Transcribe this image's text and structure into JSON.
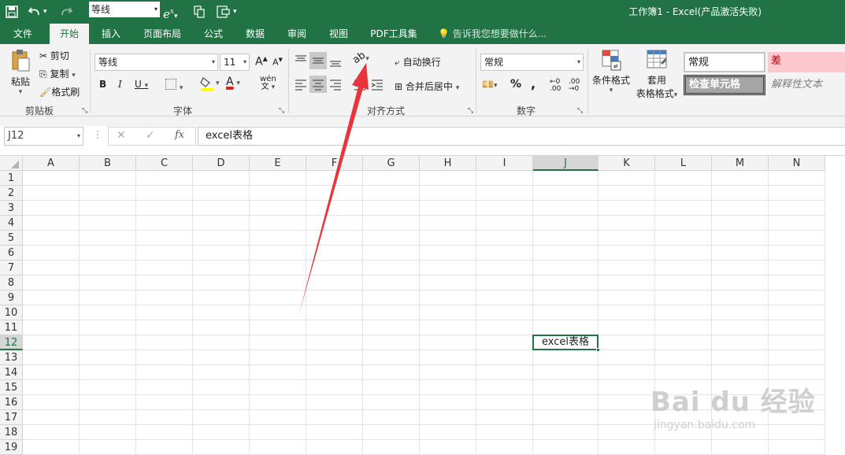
{
  "titlebar": {
    "font_name": "等线",
    "title": "工作簿1 - Excel(产品激活失败)",
    "save_icon": "save-icon",
    "undo_icon": "undo-icon",
    "redo_icon": "redo-icon"
  },
  "tabs": [
    {
      "label": "文件"
    },
    {
      "label": "开始"
    },
    {
      "label": "插入"
    },
    {
      "label": "页面布局"
    },
    {
      "label": "公式"
    },
    {
      "label": "数据"
    },
    {
      "label": "审阅"
    },
    {
      "label": "视图"
    },
    {
      "label": "PDF工具集"
    }
  ],
  "tell_me": "告诉我您想要做什么...",
  "ribbon": {
    "clipboard": {
      "paste": "粘贴",
      "cut": "剪切",
      "copy": "复制",
      "format_painter": "格式刷",
      "label": "剪贴板"
    },
    "font": {
      "name": "等线",
      "size": "11",
      "bold": "B",
      "italic": "I",
      "underline": "U",
      "label": "字体",
      "grow": "A",
      "shrink": "A",
      "wen": "wén",
      "font_color_letter": "A"
    },
    "alignment": {
      "wrap": "自动换行",
      "merge": "合并后居中",
      "label": "对齐方式"
    },
    "number": {
      "format": "常规",
      "percent": "%",
      "comma": ",",
      "label": "数字"
    },
    "styles": {
      "conditional": "条件格式",
      "table_format_1": "套用",
      "table_format_2": "表格格式",
      "normal": "常规",
      "bad": "差",
      "check_cell": "检查单元格",
      "explanatory": "解释性文本"
    }
  },
  "formula_bar": {
    "name_box": "J12",
    "fx": "fx",
    "content": "excel表格"
  },
  "grid": {
    "columns": [
      "A",
      "B",
      "C",
      "D",
      "E",
      "F",
      "G",
      "H",
      "I",
      "J",
      "K",
      "L",
      "M",
      "N"
    ],
    "rows": [
      "1",
      "2",
      "3",
      "4",
      "5",
      "6",
      "7",
      "8",
      "9",
      "10",
      "11",
      "12",
      "13",
      "14",
      "15",
      "16",
      "17",
      "18",
      "19"
    ],
    "selected_cell": "J12",
    "cell_text": "excel表格"
  },
  "watermark": {
    "brand": "Bai du 经验",
    "url": "jingyan.baidu.com"
  },
  "colors": {
    "excel_green": "#217346",
    "arrow_red": "#e8343a",
    "bad_fill": "#ffc7ce"
  }
}
